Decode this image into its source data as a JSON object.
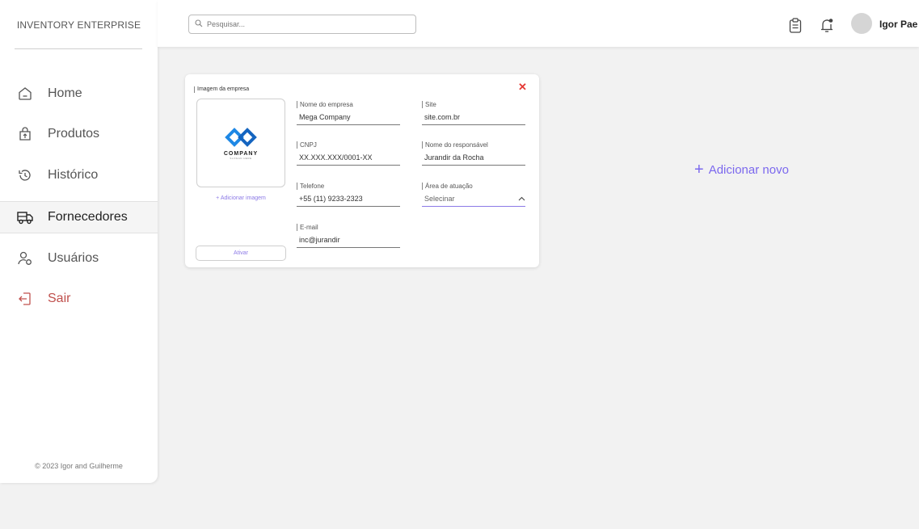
{
  "sidebar": {
    "brand": "INVENTORY ENTERPRISE",
    "items": [
      {
        "label": "Home",
        "icon": "home-icon"
      },
      {
        "label": "Produtos",
        "icon": "box-icon"
      },
      {
        "label": "Histórico",
        "icon": "history-icon"
      },
      {
        "label": "Fornecedores",
        "icon": "truck-icon"
      },
      {
        "label": "Usuários",
        "icon": "users-icon"
      },
      {
        "label": "Sair",
        "icon": "logout-icon"
      }
    ],
    "active": "Fornecedores",
    "footer": "© 2023 Igor and Guilherme"
  },
  "topbar": {
    "search_placeholder": "Pesquisar...",
    "user_name": "Igor Pae"
  },
  "supplier_card": {
    "image_label": "Imagem da empresa",
    "logo_text": "COMPANY",
    "logo_slogan": "SLOGAN HERE",
    "add_image": "Adicionar imagem",
    "activate": "Ativar",
    "fields": {
      "company_name": {
        "label": "Nome do empresa",
        "value": "Mega Company"
      },
      "site": {
        "label": "Site",
        "value": "site.com.br"
      },
      "cnpj": {
        "label": "CNPJ",
        "value": "XX.XXX.XXX/0001-XX"
      },
      "responsible": {
        "label": "Nome do responsável",
        "value": "Jurandir da Rocha"
      },
      "phone": {
        "label": "Telefone",
        "value": "+55 (11) 9233-2323"
      },
      "area": {
        "label": "Área de atuação",
        "value": "Selecinar"
      },
      "email": {
        "label": "E-mail",
        "value": "inc@jurandir"
      }
    }
  },
  "add_new": "Adicionar novo",
  "colors": {
    "accent": "#7b68ee",
    "close": "#e53935",
    "logout": "#c0504d",
    "logo_blue": "#1e88e5"
  }
}
